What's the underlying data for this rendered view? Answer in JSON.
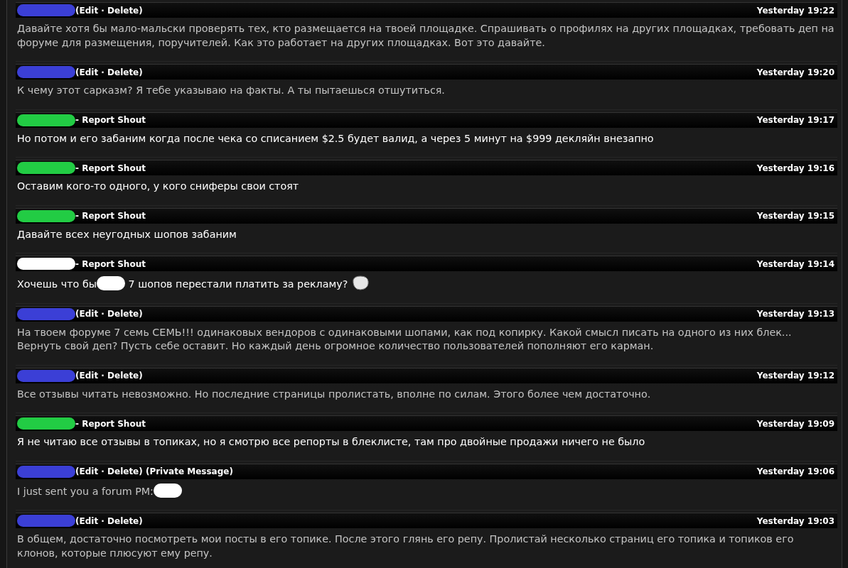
{
  "shouts": [
    {
      "user": {
        "color": "#3b3fd6"
      },
      "actions": "(Edit · Delete)",
      "time": "Yesterday 19:22",
      "kind": "own",
      "parts": [
        {
          "kind": "text",
          "text": "Давайте хотя бы мало-мальски проверять тех, кто размещается на твоей площадке. Спрашивать о профилях на других площадках, требовать деп на форуме для размещения, поручителей. Как это работает на других площадках. Вот это давайте."
        }
      ]
    },
    {
      "user": {
        "color": "#3b3fd6"
      },
      "actions": "(Edit · Delete)",
      "time": "Yesterday 19:20",
      "kind": "own",
      "parts": [
        {
          "kind": "text",
          "text": "К чему этот сарказм? Я тебе указываю на факты. А ты пытаешься отшутиться."
        }
      ]
    },
    {
      "user": {
        "color": "#22cc44"
      },
      "actions": "- Report Shout",
      "time": "Yesterday 19:17",
      "kind": "other",
      "parts": [
        {
          "kind": "text",
          "text": "Но потом и его забаним когда после чека со списанием $2.5 будет валид, а через 5 минут на $999 декляйн внезапно"
        }
      ]
    },
    {
      "user": {
        "color": "#22cc44"
      },
      "actions": "- Report Shout",
      "time": "Yesterday 19:16",
      "kind": "other",
      "parts": [
        {
          "kind": "text",
          "text": "Оставим кого-то одного, у кого сниферы свои стоят"
        }
      ]
    },
    {
      "user": {
        "color": "#22cc44"
      },
      "actions": "- Report Shout",
      "time": "Yesterday 19:15",
      "kind": "other",
      "parts": [
        {
          "kind": "text",
          "text": "Давайте всех неугодных шопов забаним"
        }
      ]
    },
    {
      "user": {
        "color": "#ffffff"
      },
      "actions": "- Report Shout",
      "time": "Yesterday 19:14",
      "kind": "other",
      "parts": [
        {
          "kind": "text",
          "text": "Хочешь что бы"
        },
        {
          "kind": "redaction"
        },
        {
          "kind": "text",
          "text": " 7 шопов перестали платить за рекламу? "
        },
        {
          "kind": "emoticon"
        }
      ]
    },
    {
      "user": {
        "color": "#3b3fd6"
      },
      "actions": "(Edit · Delete)",
      "time": "Yesterday 19:13",
      "kind": "own",
      "parts": [
        {
          "kind": "text",
          "text": "На твоем форуме 7 семь СЕМЬ!!! одинаковых вендоров с одинаковыми шопами, как под копирку. Какой смысл писать на одного из них блек... Вернуть свой деп? Пусть себе оставит. Но каждый день огромное количество пользователей пополняют его карман."
        }
      ]
    },
    {
      "user": {
        "color": "#3b3fd6"
      },
      "actions": "(Edit · Delete)",
      "time": "Yesterday 19:12",
      "kind": "own",
      "parts": [
        {
          "kind": "text",
          "text": "Все отзывы читать невозможно. Но последние страницы пролистать, вполне по силам. Этого более чем достаточно."
        }
      ]
    },
    {
      "user": {
        "color": "#22cc44"
      },
      "actions": "- Report Shout",
      "time": "Yesterday 19:09",
      "kind": "other",
      "parts": [
        {
          "kind": "text",
          "text": "Я не читаю все отзывы в топиках, но я смотрю все репорты в блеклисте, там про двойные продажи ничего не было"
        }
      ]
    },
    {
      "user": {
        "color": "#3b3fd6"
      },
      "actions": "(Edit · Delete) (Private Message)",
      "time": "Yesterday 19:06",
      "kind": "own",
      "parts": [
        {
          "kind": "text",
          "text": "I just sent you a forum PM:"
        },
        {
          "kind": "redaction"
        }
      ]
    },
    {
      "user": {
        "color": "#3b3fd6"
      },
      "actions": "(Edit · Delete)",
      "time": "Yesterday 19:03",
      "kind": "own",
      "parts": [
        {
          "kind": "text",
          "text": "В общем, достаточно посмотреть мои посты в его топике. После этого глянь его репу. Пролистай несколько страниц его топика и топиков его клонов, которые плюсуют ему репу."
        }
      ]
    }
  ]
}
